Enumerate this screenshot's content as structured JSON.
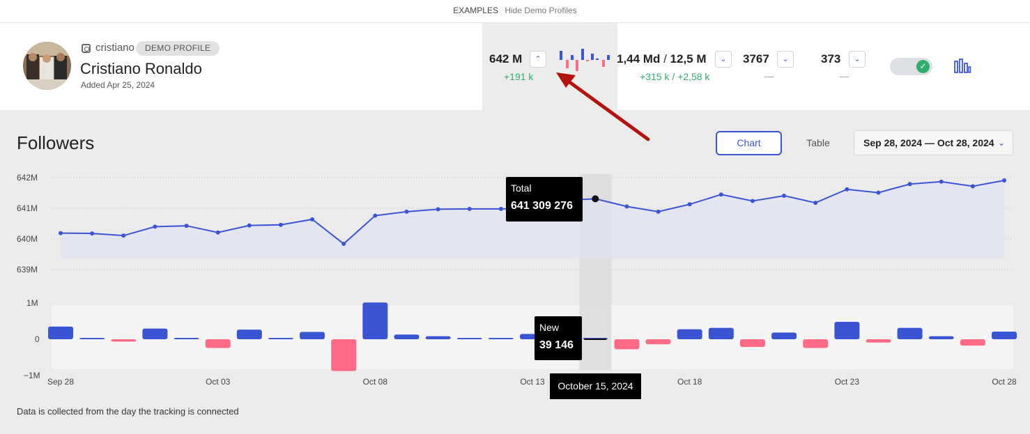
{
  "topbar": {
    "examples": "EXAMPLES",
    "hide": "Hide Demo Profiles"
  },
  "profile": {
    "username": "cristiano",
    "badge": "DEMO PROFILE",
    "name": "Cristiano Ronaldo",
    "added": "Added Apr 25, 2024"
  },
  "metrics": {
    "followers": {
      "value": "642 M",
      "delta": "+191 k",
      "icon": "chevron-up-icon"
    },
    "likes": {
      "value": "1,44 Md",
      "sep": " / ",
      "value2": "12,5 M",
      "delta": "+315 k / +2,58 k",
      "icon": "chevron-down-icon"
    },
    "m3": {
      "value": "3767",
      "delta": "—",
      "icon": "chevron-down-icon"
    },
    "m4": {
      "value": "373",
      "delta": "—",
      "icon": "chevron-down-icon"
    }
  },
  "toggle": {
    "state": "on",
    "icon": "check-icon"
  },
  "section": {
    "title": "Followers"
  },
  "view": {
    "chart_label": "Chart",
    "table_label": "Table"
  },
  "date_range": {
    "label": "Sep 28, 2024 — Oct 28, 2024",
    "icon": "chevron-down-icon"
  },
  "footnote": "Data is collected from the day the tracking is connected",
  "colors": {
    "accent": "#3a55d4",
    "positive": "#2fae6c",
    "negative": "#ff6b86"
  },
  "chart_data": [
    {
      "type": "line",
      "title": "",
      "yticks": [
        "642M",
        "641M",
        "640M",
        "639M"
      ],
      "ylim": [
        639.0,
        642.0
      ],
      "x": [
        "Sep 28",
        "Sep 29",
        "Sep 30",
        "Oct 01",
        "Oct 02",
        "Oct 03",
        "Oct 04",
        "Oct 05",
        "Oct 06",
        "Oct 07",
        "Oct 08",
        "Oct 09",
        "Oct 10",
        "Oct 11",
        "Oct 12",
        "Oct 13",
        "Oct 14",
        "Oct 15",
        "Oct 16",
        "Oct 17",
        "Oct 18",
        "Oct 19",
        "Oct 20",
        "Oct 21",
        "Oct 22",
        "Oct 23",
        "Oct 24",
        "Oct 25",
        "Oct 26",
        "Oct 27",
        "Oct 28"
      ],
      "xticks": [
        "Sep 28",
        "Oct 03",
        "Oct 08",
        "Oct 13",
        "Oct 18",
        "Oct 23",
        "Oct 28"
      ],
      "series": [
        {
          "values": [
            640.19,
            640.18,
            640.11,
            640.4,
            640.43,
            640.21,
            640.44,
            640.46,
            640.64,
            639.84,
            640.76,
            640.89,
            640.97,
            640.98,
            640.98,
            641.0,
            641.26,
            641.31,
            641.06,
            640.89,
            641.13,
            641.45,
            641.24,
            641.41,
            641.18,
            641.62,
            641.51,
            641.79,
            641.87,
            641.72,
            641.91
          ]
        }
      ],
      "grid": true,
      "tooltip": {
        "label": "Total",
        "value": "641 309 276",
        "index": 17
      }
    },
    {
      "type": "bar",
      "title": "",
      "yticks": [
        "1M",
        "0",
        "−1M"
      ],
      "ylim": [
        -1000000,
        1000000
      ],
      "x": [
        "Sep 28",
        "Sep 29",
        "Sep 30",
        "Oct 01",
        "Oct 02",
        "Oct 03",
        "Oct 04",
        "Oct 05",
        "Oct 06",
        "Oct 07",
        "Oct 08",
        "Oct 09",
        "Oct 10",
        "Oct 11",
        "Oct 12",
        "Oct 13",
        "Oct 14",
        "Oct 15",
        "Oct 16",
        "Oct 17",
        "Oct 18",
        "Oct 19",
        "Oct 20",
        "Oct 21",
        "Oct 22",
        "Oct 23",
        "Oct 24",
        "Oct 25",
        "Oct 26",
        "Oct 27",
        "Oct 28"
      ],
      "series": [
        {
          "values": [
            380000,
            0,
            -70000,
            320000,
            30000,
            -260000,
            290000,
            20000,
            220000,
            -950000,
            1100000,
            140000,
            90000,
            20000,
            0,
            160000,
            null,
            39146,
            -300000,
            -150000,
            300000,
            340000,
            -230000,
            200000,
            -260000,
            520000,
            -100000,
            340000,
            90000,
            -190000,
            230000
          ]
        }
      ],
      "tooltip": {
        "label": "New",
        "value": "39 146",
        "index": 17
      },
      "hover_date": "October 15, 2024"
    }
  ]
}
